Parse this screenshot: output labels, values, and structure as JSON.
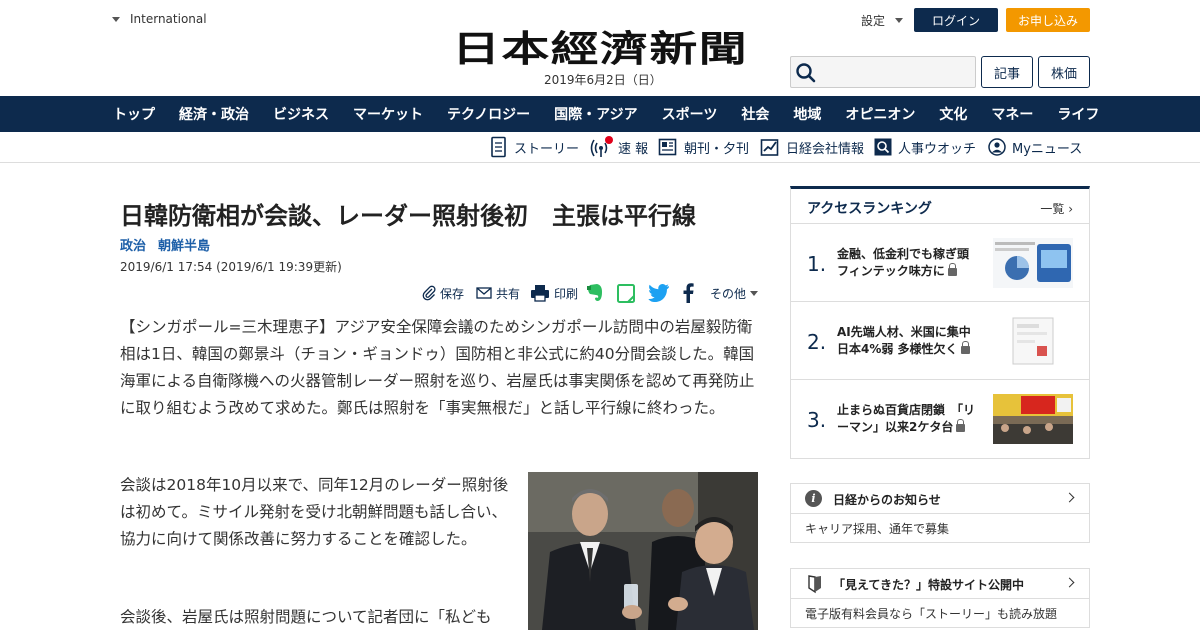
{
  "header": {
    "edition": "International",
    "logo": "日本經濟新聞",
    "date": "2019年6月2日（日）",
    "settings": "設定",
    "login": "ログイン",
    "apply": "お申し込み",
    "search_placeholder": "",
    "kiji": "記事",
    "kabuka": "株価"
  },
  "gnav": [
    "トップ",
    "経済・政治",
    "ビジネス",
    "マーケット",
    "テクノロジー",
    "国際・アジア",
    "スポーツ",
    "社会",
    "地域",
    "オピニオン",
    "文化",
    "マネー",
    "ライフ"
  ],
  "subnav": {
    "story": "ストーリー",
    "sokuho": "速 報",
    "choukan": "朝刊・夕刊",
    "kaisha": "日経会社情報",
    "jinji": "人事ウオッチ",
    "mynews": "Myニュース"
  },
  "article": {
    "headline": "日韓防衛相が会談、レーダー照射後初　主張は平行線",
    "tag1": "政治",
    "tag2": "朝鮮半島",
    "date": "2019/6/1 17:54 (2019/6/1 19:39更新)",
    "share": {
      "save": "保存",
      "share": "共有",
      "print": "印刷",
      "more": "その他"
    },
    "p1": "【シンガポール=三木理恵子】アジア安全保障会議のためシンガポール訪問中の岩屋毅防衛相は1日、韓国の鄭景斗（チョン・ギョンドゥ）国防相と非公式に約40分間会談した。韓国海軍による自衛隊機への火器管制レーダー照射を巡り、岩屋氏は事実関係を認めて再発防止に取り組むよう改めて求めた。鄭氏は照射を「事実無根だ」と話し平行線に終わった。",
    "p2": "会談は2018年10月以来で、同年12月のレーダー照射後は初めて。ミサイル発射を受け北朝鮮問題も話し合い、協力に向けて関係改善に努力することを確認した。",
    "p3": "会談後、岩屋氏は照射問題について記者団に「私ども"
  },
  "ranking": {
    "title": "アクセスランキング",
    "all": "一覧",
    "items": [
      {
        "num": "1.",
        "line1": "金融、低金利でも稼ぎ頭",
        "line2": "フィンテック味方に"
      },
      {
        "num": "2.",
        "line1": "AI先端人材、米国に集中",
        "line2": "日本4%弱 多様性欠く"
      },
      {
        "num": "3.",
        "line1": "止まらぬ百貨店閉鎖　「リ",
        "line2": "ーマン」以来2ケタ台"
      }
    ]
  },
  "notice": {
    "title": "日経からのお知らせ",
    "body": "キャリア採用、通年で募集"
  },
  "mieteki": {
    "title": "「見えてきた？」特設サイト公開中",
    "body": "電子版有料会員なら「ストーリー」も読み放題"
  },
  "colors": {
    "navy": "#0d2a4d",
    "orange": "#f39800",
    "tag_blue": "#1d5fa8"
  }
}
